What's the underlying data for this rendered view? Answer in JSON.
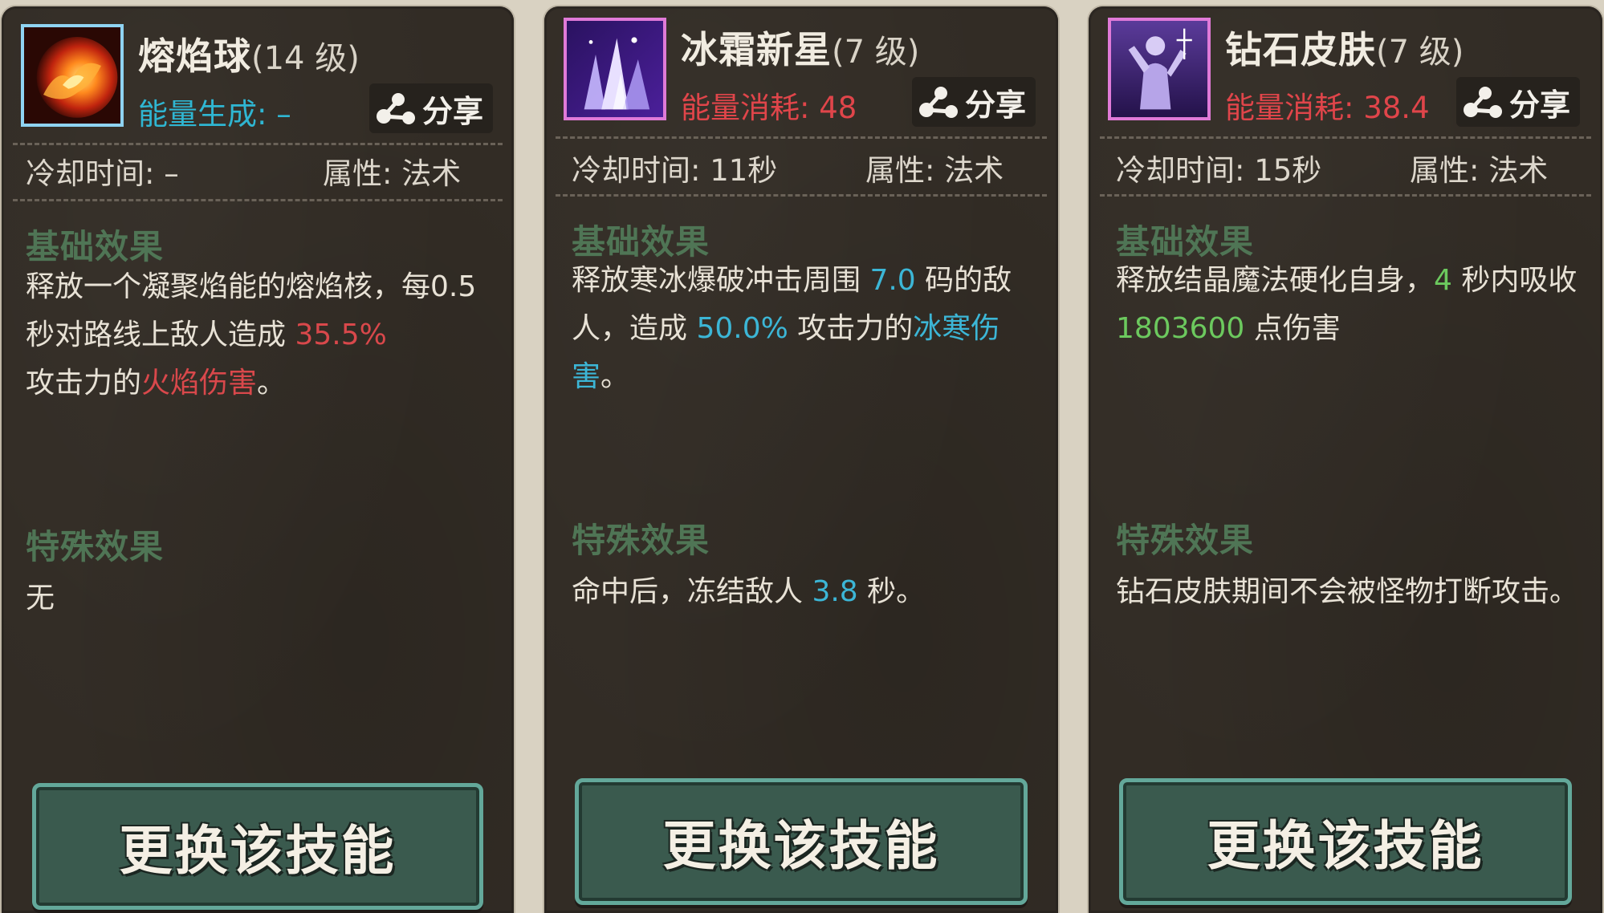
{
  "colors": {
    "icon_border_common": "#8fd3f2",
    "icon_border_epic": "#e07ad8",
    "energy_gain": "#2fb6d2",
    "energy_cost": "#e0454a",
    "section_heading": "#4f7555",
    "highlight_blue": "#3cb6d6",
    "highlight_red": "#d9484b",
    "highlight_green": "#6cc95e"
  },
  "cards": [
    {
      "icon": "fireball-icon",
      "name": "熔焰球",
      "level": "(14 级)",
      "energy": "能量生成: –",
      "share": "分享",
      "cooldown": "冷却时间: –",
      "attribute": "属性: 法术",
      "base_heading": "基础效果",
      "base_desc": {
        "p1": "释放一个凝聚焰能的熔焰核，每",
        "p2": "0.5 秒对路线上敌人造成 ",
        "v1": "35.5%",
        "p3": "攻击力的",
        "v2": "火焰伤害",
        "p4": "。"
      },
      "special_heading": "特殊效果",
      "special_desc": {
        "p1": "无"
      },
      "button": "更换该技能"
    },
    {
      "icon": "frost-nova-icon",
      "name": "冰霜新星",
      "level": "(7 级)",
      "energy": "能量消耗: 48",
      "share": "分享",
      "cooldown": "冷却时间: 11秒",
      "attribute": "属性: 法术",
      "base_heading": "基础效果",
      "base_desc": {
        "p1": "释放寒冰爆破冲击周围 ",
        "v1": "7.0",
        "p2": " 码的敌人，造成 ",
        "v2": "50.0%",
        "p3": " 攻击力的",
        "v3": "冰寒伤害",
        "p4": "。"
      },
      "special_heading": "特殊效果",
      "special_desc": {
        "p1": "命中后，冻结敌人 ",
        "v1": "3.8",
        "p2": " 秒。"
      },
      "button": "更换该技能"
    },
    {
      "icon": "diamond-skin-icon",
      "name": "钻石皮肤",
      "level": "(7 级)",
      "energy": "能量消耗: 38.4",
      "share": "分享",
      "cooldown": "冷却时间: 15秒",
      "attribute": "属性: 法术",
      "base_heading": "基础效果",
      "base_desc": {
        "p1": "释放结晶魔法硬化自身，",
        "v1": "4",
        "p2": " 秒内吸收 ",
        "v2": "1803600",
        "p3": " 点伤害"
      },
      "special_heading": "特殊效果",
      "special_desc": {
        "p1": "钻石皮肤期间不会被怪物打断攻击。"
      },
      "button": "更换该技能"
    }
  ]
}
